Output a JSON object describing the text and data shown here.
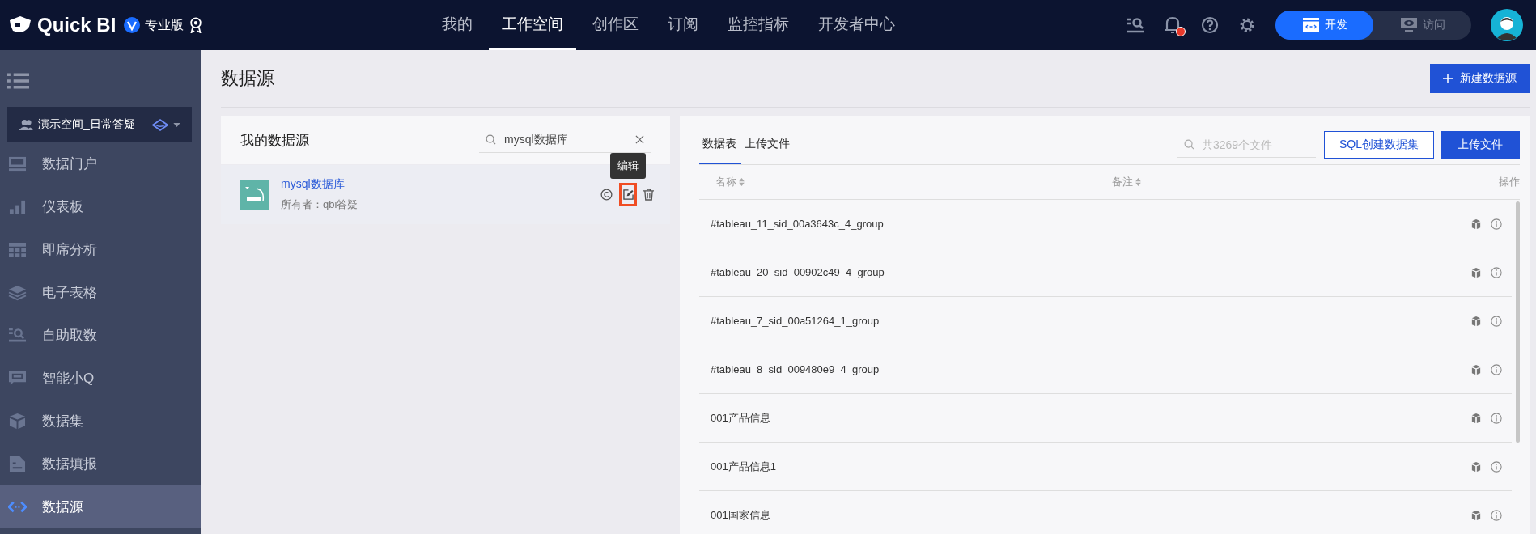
{
  "top_bar": {
    "logo": "Quick BI",
    "edition": "专业版",
    "nav": [
      {
        "label": "我的",
        "selected": false
      },
      {
        "label": "工作空间",
        "selected": true
      },
      {
        "label": "创作区",
        "selected": false
      },
      {
        "label": "订阅",
        "selected": false
      },
      {
        "label": "监控指标",
        "selected": false
      },
      {
        "label": "开发者中心",
        "selected": false
      }
    ],
    "has_notification": true,
    "mode_switch": [
      {
        "label": "开发",
        "selected": true
      },
      {
        "label": "访问",
        "selected": false
      }
    ]
  },
  "sidebar": {
    "workspace": "演示空间_日常答疑",
    "items": [
      {
        "label": "数据门户",
        "selected": false
      },
      {
        "label": "仪表板",
        "selected": false
      },
      {
        "label": "即席分析",
        "selected": false
      },
      {
        "label": "电子表格",
        "selected": false
      },
      {
        "label": "自助取数",
        "selected": false
      },
      {
        "label": "智能小Q",
        "selected": false
      },
      {
        "label": "数据集",
        "selected": false
      },
      {
        "label": "数据填报",
        "selected": false
      },
      {
        "label": "数据源",
        "selected": true
      }
    ]
  },
  "page": {
    "title": "数据源",
    "new_button": "新建数据源"
  },
  "my_sources": {
    "title": "我的数据源",
    "search": {
      "value": "mysql数据库"
    },
    "tooltip": "编辑",
    "items": [
      {
        "name": "mysql数据库",
        "owner": "所有者：qbi答疑"
      }
    ]
  },
  "tables_panel": {
    "tabs": [
      {
        "label": "数据表",
        "selected": true
      },
      {
        "label": "上传文件",
        "selected": false
      }
    ],
    "search": {
      "placeholder": "共3269个文件"
    },
    "buttons": [
      {
        "label": "SQL创建数据集",
        "kind": "outline"
      },
      {
        "label": "上传文件",
        "kind": "primary"
      }
    ],
    "columns": [
      "名称",
      "备注",
      "操作"
    ],
    "rows": [
      {
        "name": "#tableau_11_sid_00a3643c_4_group"
      },
      {
        "name": "#tableau_20_sid_00902c49_4_group"
      },
      {
        "name": "#tableau_7_sid_00a51264_1_group"
      },
      {
        "name": "#tableau_8_sid_009480e9_4_group"
      },
      {
        "name": "001产品信息"
      },
      {
        "name": "001产品信息1"
      },
      {
        "name": "001国家信息"
      }
    ]
  }
}
